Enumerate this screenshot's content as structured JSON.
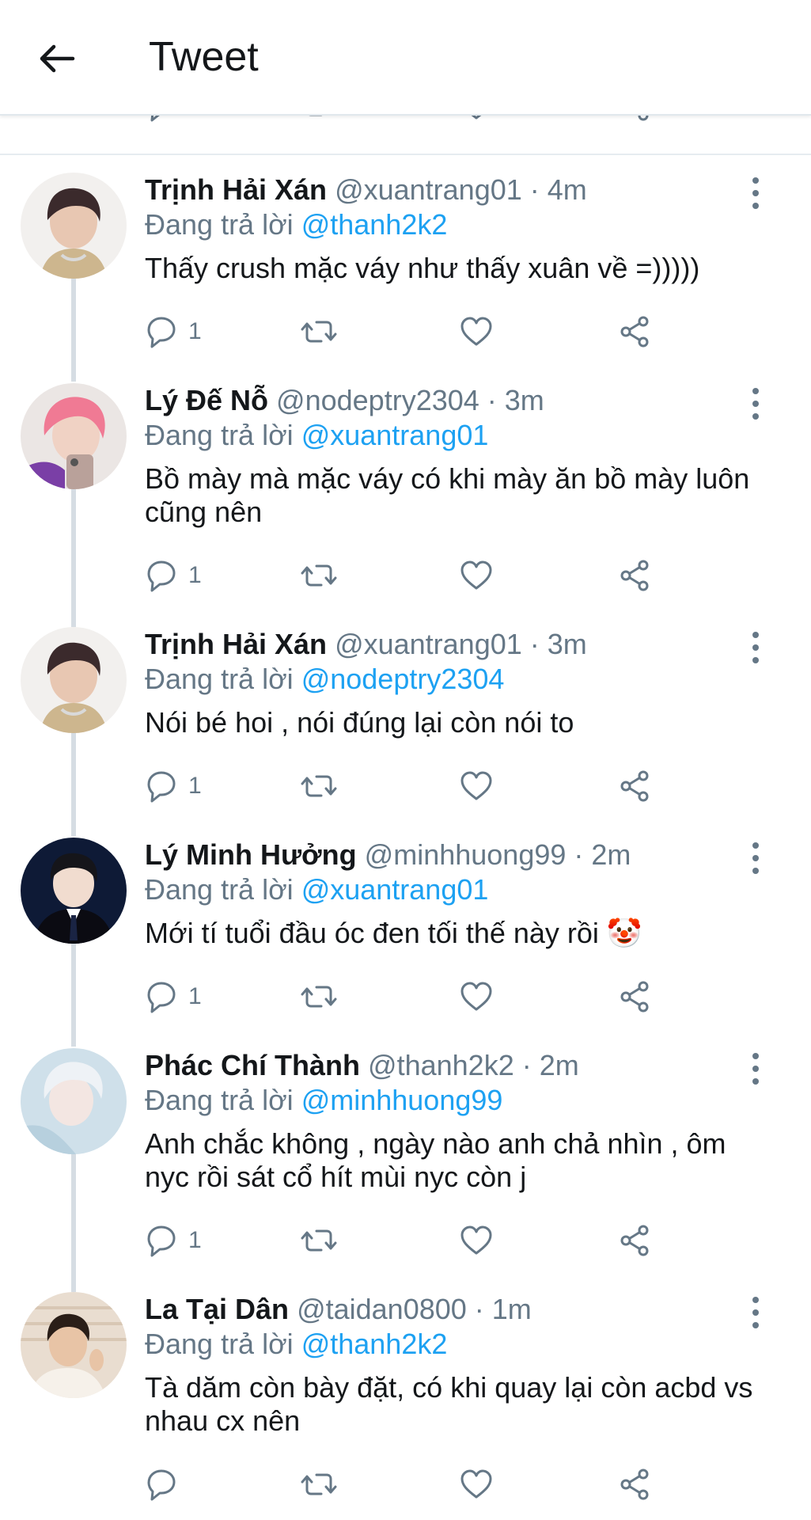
{
  "header": {
    "title": "Tweet",
    "back_icon": "arrow-left-icon"
  },
  "colors": {
    "link": "#1da1f2",
    "muted": "#657786",
    "text": "#14171a",
    "divider": "#e6ecf0"
  },
  "tweets": [
    {
      "name": "Trịnh Hải Xán",
      "meta": "@xuantrang01 · 4m",
      "replying_label": "Đang trả lời ",
      "replying_to": "@thanh2k2",
      "text": "Thấy crush mặc váy như thấy xuân về =)))))",
      "reply_count": "1",
      "retweet_count": "",
      "like_count": ""
    },
    {
      "name": "Lý Đế Nỗ",
      "meta": "@nodeptry2304 · 3m",
      "replying_label": "Đang trả lời ",
      "replying_to": "@xuantrang01",
      "text": "Bồ mày mà mặc váy có khi mày ăn bồ mày luôn cũng nên",
      "reply_count": "1",
      "retweet_count": "",
      "like_count": ""
    },
    {
      "name": "Trịnh Hải Xán",
      "meta": "@xuantrang01 · 3m",
      "replying_label": "Đang trả lời ",
      "replying_to": "@nodeptry2304",
      "text": "Nói bé hoi , nói đúng lại còn nói to",
      "reply_count": "1",
      "retweet_count": "",
      "like_count": ""
    },
    {
      "name": "Lý Minh Hưởng",
      "meta": "@minhhuong99 · 2m",
      "replying_label": "Đang trả lời ",
      "replying_to": "@xuantrang01",
      "text": "Mới tí tuổi đầu óc đen tối thế này rồi 🤡",
      "reply_count": "1",
      "retweet_count": "",
      "like_count": ""
    },
    {
      "name": "Phác Chí Thành",
      "meta": "@thanh2k2 · 2m",
      "replying_label": "Đang trả lời ",
      "replying_to": "@minhhuong99",
      "text": "Anh chắc không , ngày nào anh chả nhìn , ôm nyc rồi sát cổ hít mùi nyc còn j",
      "reply_count": "1",
      "retweet_count": "",
      "like_count": ""
    },
    {
      "name": "La Tại Dân",
      "meta": "@taidan0800 · 1m",
      "replying_label": "Đang trả lời ",
      "replying_to": "@thanh2k2",
      "text": "Tà dăm còn bày đặt, có khi quay lại còn acbd vs nhau cx nên",
      "reply_count": "",
      "retweet_count": "",
      "like_count": ""
    }
  ]
}
